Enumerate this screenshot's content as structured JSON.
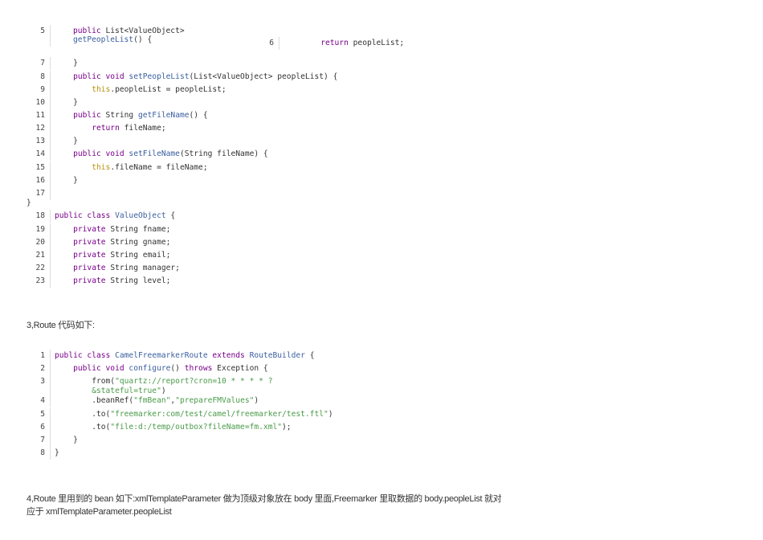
{
  "block1": {
    "lines": [
      {
        "n": "5",
        "rows": [
          [
            [
              "k",
              "public "
            ],
            [
              "p",
              "List<ValueObject>"
            ]
          ],
          [
            [
              "f",
              "getPeopleList"
            ],
            [
              "p",
              "() {"
            ]
          ]
        ]
      },
      {
        "n": "6",
        "rows": [
          [
            [
              "k",
              "        return "
            ],
            [
              "p",
              "peopleList;"
            ]
          ]
        ]
      },
      {
        "n": "7",
        "rows": [
          [
            [
              "p",
              "    }"
            ]
          ]
        ]
      },
      {
        "n": "8",
        "rows": [
          [
            [
              "k",
              "    public void "
            ],
            [
              "f",
              "setPeopleList"
            ],
            [
              "p",
              "(List<ValueObject> peopleList) {"
            ]
          ]
        ]
      },
      {
        "n": "9",
        "rows": [
          [
            [
              "t",
              "        this"
            ],
            [
              "p",
              ".peopleList = peopleList;"
            ]
          ]
        ]
      },
      {
        "n": "10",
        "rows": [
          [
            [
              "p",
              "    }"
            ]
          ]
        ]
      },
      {
        "n": "11",
        "rows": [
          [
            [
              "k",
              "    public "
            ],
            [
              "p",
              "String "
            ],
            [
              "f",
              "getFileName"
            ],
            [
              "p",
              "() {"
            ]
          ]
        ]
      },
      {
        "n": "12",
        "rows": [
          [
            [
              "k",
              "        return "
            ],
            [
              "p",
              "fileName;"
            ]
          ]
        ]
      },
      {
        "n": "13",
        "rows": [
          [
            [
              "p",
              "    }"
            ]
          ]
        ]
      },
      {
        "n": "14",
        "rows": [
          [
            [
              "k",
              "    public void "
            ],
            [
              "f",
              "setFileName"
            ],
            [
              "p",
              "(String fileName) {"
            ]
          ]
        ]
      },
      {
        "n": "15",
        "rows": [
          [
            [
              "t",
              "        this"
            ],
            [
              "p",
              ".fileName = fileName;"
            ]
          ]
        ]
      },
      {
        "n": "16",
        "rows": [
          [
            [
              "p",
              "    }"
            ]
          ]
        ]
      },
      {
        "n": "17",
        "rows": [
          [
            [
              "p",
              ""
            ]
          ]
        ]
      },
      {
        "n": "",
        "rows": [
          [
            [
              "p",
              "}"
            ]
          ]
        ]
      },
      {
        "n": "18",
        "rows": [
          [
            [
              "k",
              "public class "
            ],
            [
              "f",
              "ValueObject"
            ],
            [
              "p",
              " {"
            ]
          ]
        ]
      },
      {
        "n": "19",
        "rows": [
          [
            [
              "k",
              "    private "
            ],
            [
              "p",
              "String fname;"
            ]
          ]
        ]
      },
      {
        "n": "20",
        "rows": [
          [
            [
              "k",
              "    private "
            ],
            [
              "p",
              "String gname;"
            ]
          ]
        ]
      },
      {
        "n": "21",
        "rows": [
          [
            [
              "k",
              "    private "
            ],
            [
              "p",
              "String email;"
            ]
          ]
        ]
      },
      {
        "n": "22",
        "rows": [
          [
            [
              "k",
              "    private "
            ],
            [
              "p",
              "String manager;"
            ]
          ]
        ]
      },
      {
        "n": "23",
        "rows": [
          [
            [
              "k",
              "    private "
            ],
            [
              "p",
              "String level;"
            ]
          ]
        ]
      }
    ]
  },
  "heading3": "3,Route 代码如下:",
  "block2": {
    "lines": [
      {
        "n": "1",
        "rows": [
          [
            [
              "k",
              "public class "
            ],
            [
              "f",
              "CamelFreemarkerRoute"
            ],
            [
              "k",
              " extends "
            ],
            [
              "f",
              "RouteBuilder"
            ],
            [
              "p",
              " {"
            ]
          ]
        ]
      },
      {
        "n": "2",
        "rows": [
          [
            [
              "k",
              "    public void "
            ],
            [
              "f",
              "configure"
            ],
            [
              "p",
              "() "
            ],
            [
              "k",
              "throws "
            ],
            [
              "p",
              "Exception {"
            ]
          ]
        ]
      },
      {
        "n": "3",
        "rows": [
          [
            [
              "p",
              "        from("
            ],
            [
              "s",
              "\"quartz://report?cron=10 * * * * ?"
            ]
          ],
          [
            [
              "s",
              "        &stateful=true\""
            ],
            [
              "p",
              ")"
            ]
          ]
        ]
      },
      {
        "n": "4",
        "rows": [
          [
            [
              "p",
              "        .beanRef("
            ],
            [
              "s",
              "\"fmBean\""
            ],
            [
              "p",
              ","
            ],
            [
              "s",
              "\"prepareFMValues\""
            ],
            [
              "p",
              ")"
            ]
          ]
        ]
      },
      {
        "n": "5",
        "rows": [
          [
            [
              "p",
              "        .to("
            ],
            [
              "s",
              "\"freemarker:com/test/camel/freemarker/test.ftl\""
            ],
            [
              "p",
              ")"
            ]
          ]
        ]
      },
      {
        "n": "6",
        "rows": [
          [
            [
              "p",
              "        .to("
            ],
            [
              "s",
              "\"file:d:/temp/outbox?fileName=fm.xml\""
            ],
            [
              "p",
              ");"
            ]
          ]
        ]
      },
      {
        "n": "7",
        "rows": [
          [
            [
              "p",
              "    }"
            ]
          ]
        ]
      },
      {
        "n": "8",
        "rows": [
          [
            [
              "p",
              "}"
            ]
          ]
        ]
      }
    ]
  },
  "para4": {
    "line1": "4,Route 里用到的 bean 如下:xmlTemplateParameter 做为顶级对象放在 body 里面,Freemarker 里取数据的 body.peopleList 就对",
    "line2": "应于 xmlTemplateParameter.peopleList"
  }
}
